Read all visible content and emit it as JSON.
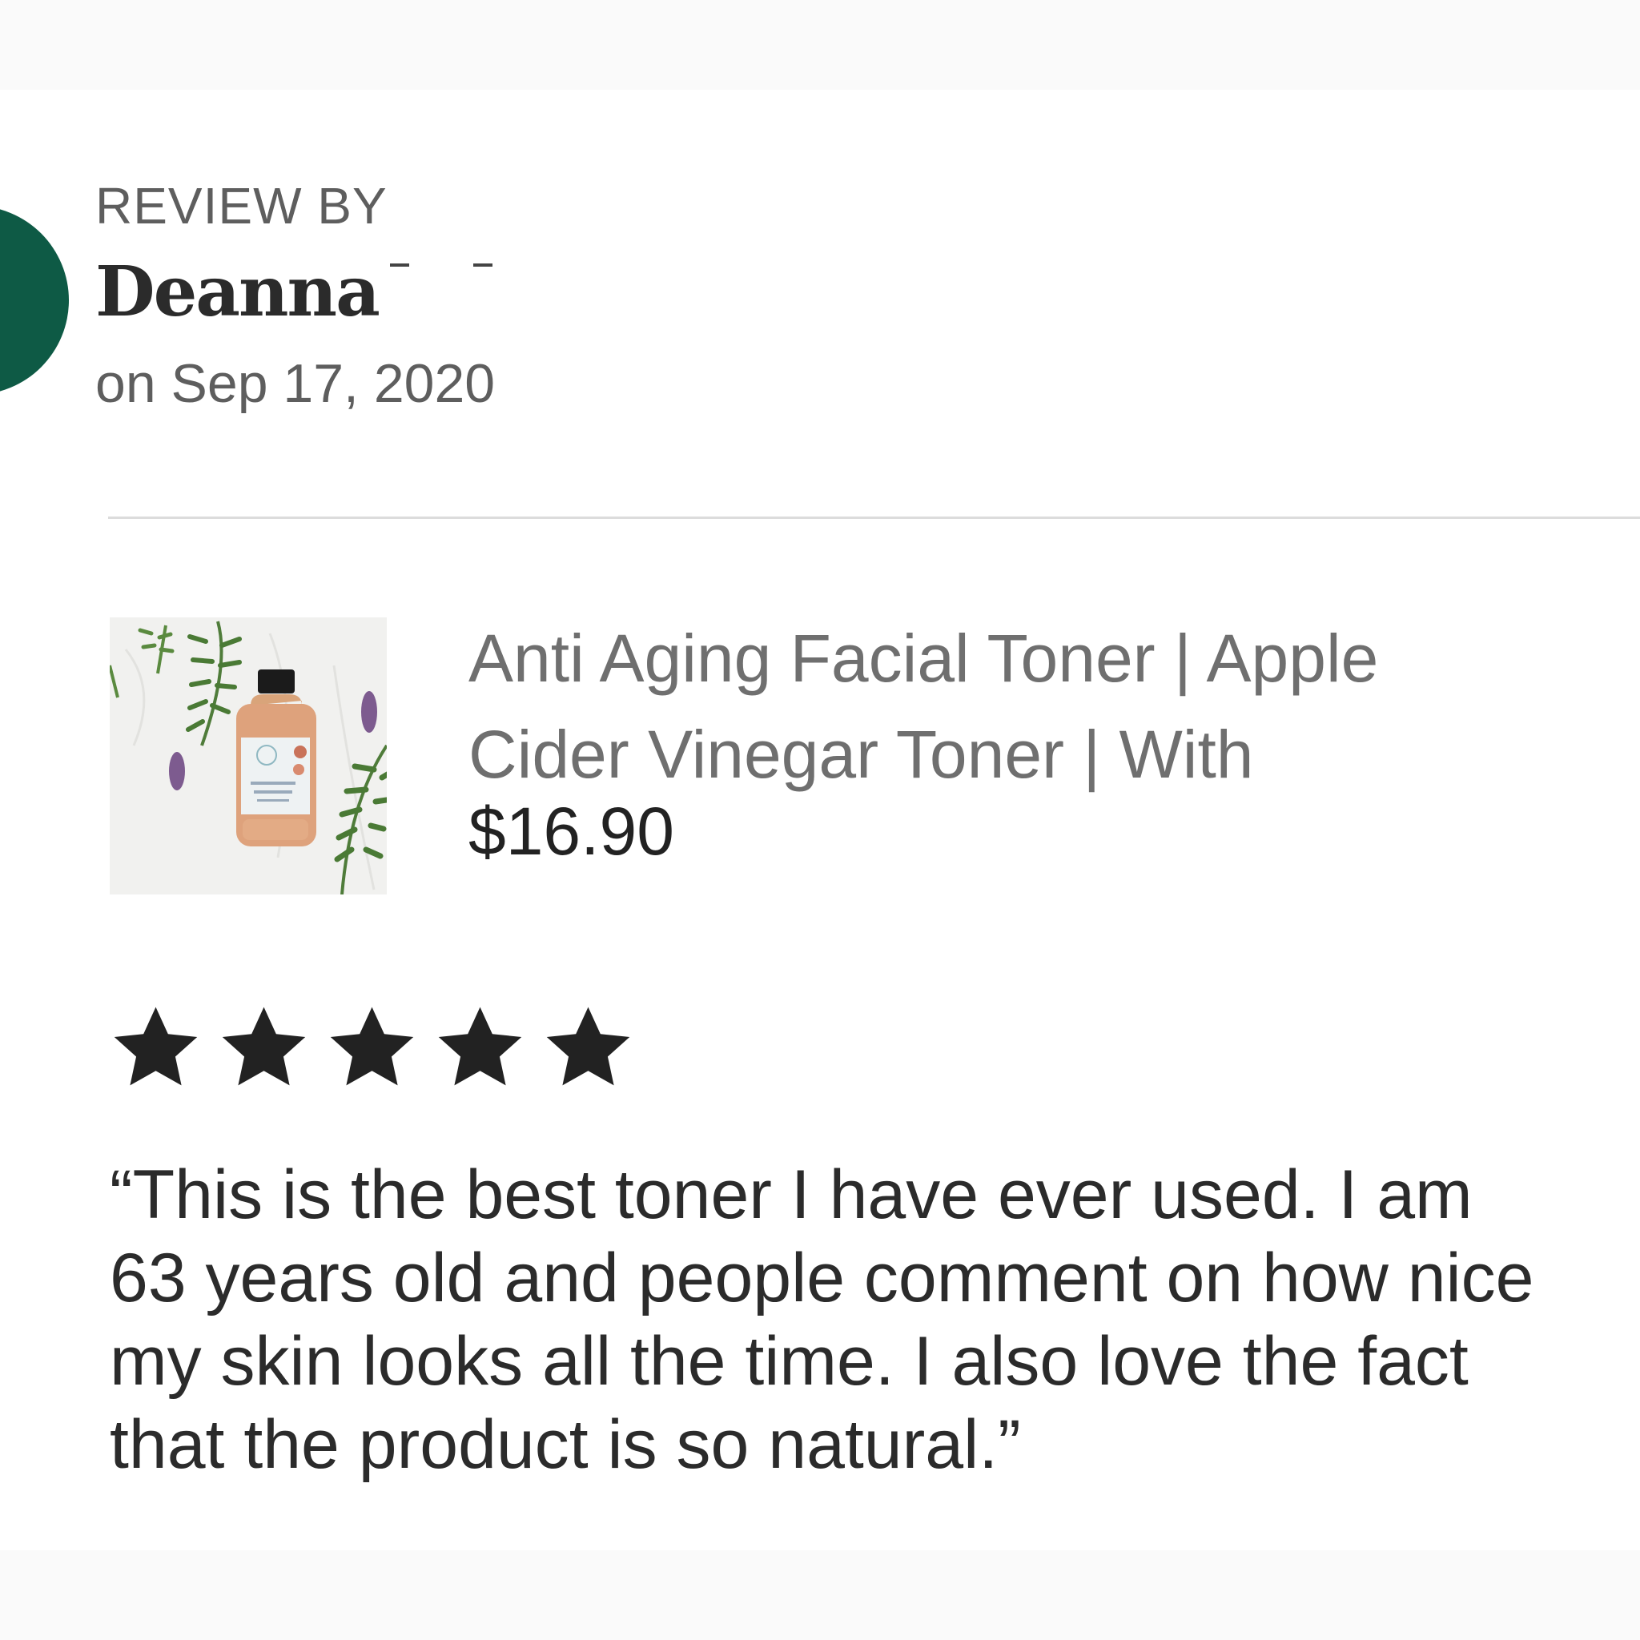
{
  "reviewer": {
    "heading": "REVIEW BY",
    "name": "Deanna",
    "date": "on Sep 17, 2020"
  },
  "avatar_color": "#0e5a45",
  "product": {
    "title_line1": "Anti Aging Facial Toner | Apple",
    "title_line2": "Cider Vinegar Toner | With",
    "price": "$16.90",
    "thumbnail_icon": "toner-bottle-with-herbs"
  },
  "rating": {
    "stars": 5,
    "max": 5,
    "star_icon": "star-icon",
    "color": "#222222"
  },
  "review": {
    "lines": [
      "“This is the best toner I have ever used.  I am",
      "63 years old and people comment on how nice",
      "my skin looks all the time.  I also love the fact",
      "that the product is so natural.”"
    ]
  }
}
